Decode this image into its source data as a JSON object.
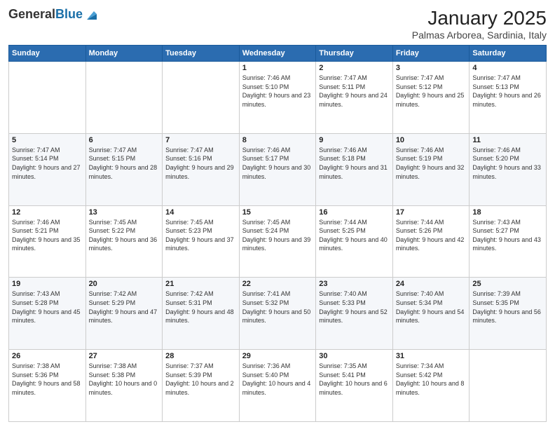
{
  "header": {
    "logo_general": "General",
    "logo_blue": "Blue",
    "title": "January 2025",
    "location": "Palmas Arborea, Sardinia, Italy"
  },
  "weekdays": [
    "Sunday",
    "Monday",
    "Tuesday",
    "Wednesday",
    "Thursday",
    "Friday",
    "Saturday"
  ],
  "weeks": [
    [
      {
        "day": "",
        "info": ""
      },
      {
        "day": "",
        "info": ""
      },
      {
        "day": "",
        "info": ""
      },
      {
        "day": "1",
        "info": "Sunrise: 7:46 AM\nSunset: 5:10 PM\nDaylight: 9 hours\nand 23 minutes."
      },
      {
        "day": "2",
        "info": "Sunrise: 7:47 AM\nSunset: 5:11 PM\nDaylight: 9 hours\nand 24 minutes."
      },
      {
        "day": "3",
        "info": "Sunrise: 7:47 AM\nSunset: 5:12 PM\nDaylight: 9 hours\nand 25 minutes."
      },
      {
        "day": "4",
        "info": "Sunrise: 7:47 AM\nSunset: 5:13 PM\nDaylight: 9 hours\nand 26 minutes."
      }
    ],
    [
      {
        "day": "5",
        "info": "Sunrise: 7:47 AM\nSunset: 5:14 PM\nDaylight: 9 hours\nand 27 minutes."
      },
      {
        "day": "6",
        "info": "Sunrise: 7:47 AM\nSunset: 5:15 PM\nDaylight: 9 hours\nand 28 minutes."
      },
      {
        "day": "7",
        "info": "Sunrise: 7:47 AM\nSunset: 5:16 PM\nDaylight: 9 hours\nand 29 minutes."
      },
      {
        "day": "8",
        "info": "Sunrise: 7:46 AM\nSunset: 5:17 PM\nDaylight: 9 hours\nand 30 minutes."
      },
      {
        "day": "9",
        "info": "Sunrise: 7:46 AM\nSunset: 5:18 PM\nDaylight: 9 hours\nand 31 minutes."
      },
      {
        "day": "10",
        "info": "Sunrise: 7:46 AM\nSunset: 5:19 PM\nDaylight: 9 hours\nand 32 minutes."
      },
      {
        "day": "11",
        "info": "Sunrise: 7:46 AM\nSunset: 5:20 PM\nDaylight: 9 hours\nand 33 minutes."
      }
    ],
    [
      {
        "day": "12",
        "info": "Sunrise: 7:46 AM\nSunset: 5:21 PM\nDaylight: 9 hours\nand 35 minutes."
      },
      {
        "day": "13",
        "info": "Sunrise: 7:45 AM\nSunset: 5:22 PM\nDaylight: 9 hours\nand 36 minutes."
      },
      {
        "day": "14",
        "info": "Sunrise: 7:45 AM\nSunset: 5:23 PM\nDaylight: 9 hours\nand 37 minutes."
      },
      {
        "day": "15",
        "info": "Sunrise: 7:45 AM\nSunset: 5:24 PM\nDaylight: 9 hours\nand 39 minutes."
      },
      {
        "day": "16",
        "info": "Sunrise: 7:44 AM\nSunset: 5:25 PM\nDaylight: 9 hours\nand 40 minutes."
      },
      {
        "day": "17",
        "info": "Sunrise: 7:44 AM\nSunset: 5:26 PM\nDaylight: 9 hours\nand 42 minutes."
      },
      {
        "day": "18",
        "info": "Sunrise: 7:43 AM\nSunset: 5:27 PM\nDaylight: 9 hours\nand 43 minutes."
      }
    ],
    [
      {
        "day": "19",
        "info": "Sunrise: 7:43 AM\nSunset: 5:28 PM\nDaylight: 9 hours\nand 45 minutes."
      },
      {
        "day": "20",
        "info": "Sunrise: 7:42 AM\nSunset: 5:29 PM\nDaylight: 9 hours\nand 47 minutes."
      },
      {
        "day": "21",
        "info": "Sunrise: 7:42 AM\nSunset: 5:31 PM\nDaylight: 9 hours\nand 48 minutes."
      },
      {
        "day": "22",
        "info": "Sunrise: 7:41 AM\nSunset: 5:32 PM\nDaylight: 9 hours\nand 50 minutes."
      },
      {
        "day": "23",
        "info": "Sunrise: 7:40 AM\nSunset: 5:33 PM\nDaylight: 9 hours\nand 52 minutes."
      },
      {
        "day": "24",
        "info": "Sunrise: 7:40 AM\nSunset: 5:34 PM\nDaylight: 9 hours\nand 54 minutes."
      },
      {
        "day": "25",
        "info": "Sunrise: 7:39 AM\nSunset: 5:35 PM\nDaylight: 9 hours\nand 56 minutes."
      }
    ],
    [
      {
        "day": "26",
        "info": "Sunrise: 7:38 AM\nSunset: 5:36 PM\nDaylight: 9 hours\nand 58 minutes."
      },
      {
        "day": "27",
        "info": "Sunrise: 7:38 AM\nSunset: 5:38 PM\nDaylight: 10 hours\nand 0 minutes."
      },
      {
        "day": "28",
        "info": "Sunrise: 7:37 AM\nSunset: 5:39 PM\nDaylight: 10 hours\nand 2 minutes."
      },
      {
        "day": "29",
        "info": "Sunrise: 7:36 AM\nSunset: 5:40 PM\nDaylight: 10 hours\nand 4 minutes."
      },
      {
        "day": "30",
        "info": "Sunrise: 7:35 AM\nSunset: 5:41 PM\nDaylight: 10 hours\nand 6 minutes."
      },
      {
        "day": "31",
        "info": "Sunrise: 7:34 AM\nSunset: 5:42 PM\nDaylight: 10 hours\nand 8 minutes."
      },
      {
        "day": "",
        "info": ""
      }
    ]
  ]
}
